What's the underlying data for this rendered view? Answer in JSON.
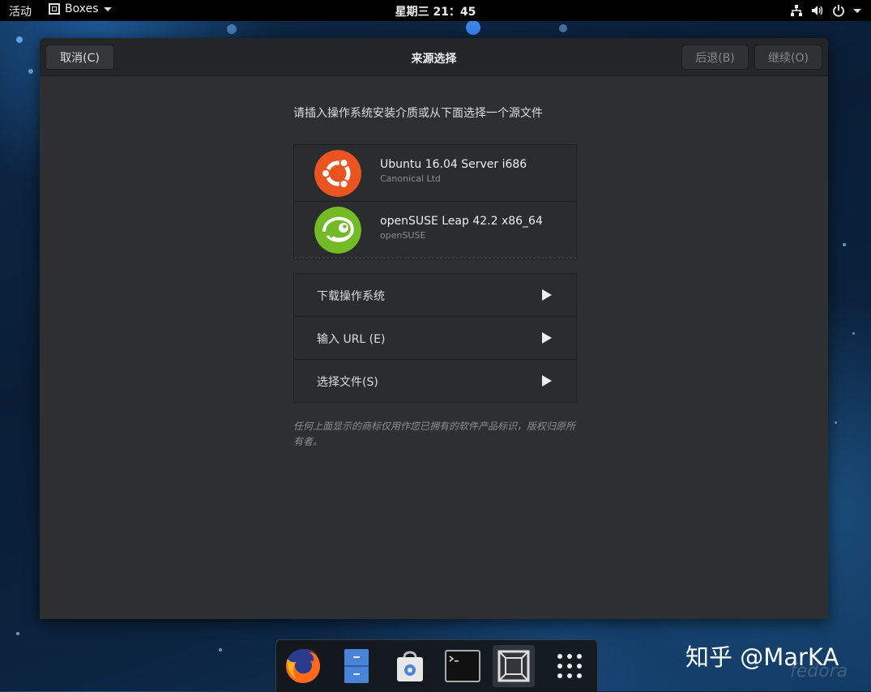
{
  "topbar": {
    "activities": "活动",
    "app_name": "Boxes",
    "clock": "星期三 21：45"
  },
  "window": {
    "title": "来源选择",
    "cancel": "取消(C)",
    "back": "后退(B)",
    "continue": "继续(O)"
  },
  "content": {
    "instruction": "请插入操作系统安装介质或从下面选择一个源文件",
    "media": [
      {
        "name": "Ubuntu 16.04 Server i686",
        "vendor": "Canonical Ltd",
        "logo": "ubuntu-logo"
      },
      {
        "name": "openSUSE Leap 42.2 x86_64",
        "vendor": "openSUSE",
        "logo": "opensuse-logo"
      }
    ],
    "actions": [
      {
        "label": "下载操作系统"
      },
      {
        "label": "输入 URL (E)"
      },
      {
        "label": "选择文件(S)"
      }
    ],
    "disclaimer": "任何上面显示的商标仅用作您已拥有的软件产品标识，版权归原所有者。"
  },
  "dock": {
    "apps": [
      "firefox-icon",
      "files-icon",
      "software-icon",
      "terminal-icon",
      "boxes-icon",
      "app-grid-icon"
    ]
  },
  "watermark": "知乎 @MarKA",
  "background_mark": "fedora",
  "colors": {
    "ubuntu": "#e95420",
    "opensuse": "#73ba25",
    "window_bg": "#2d2f31",
    "topbar_bg": "#000000"
  }
}
